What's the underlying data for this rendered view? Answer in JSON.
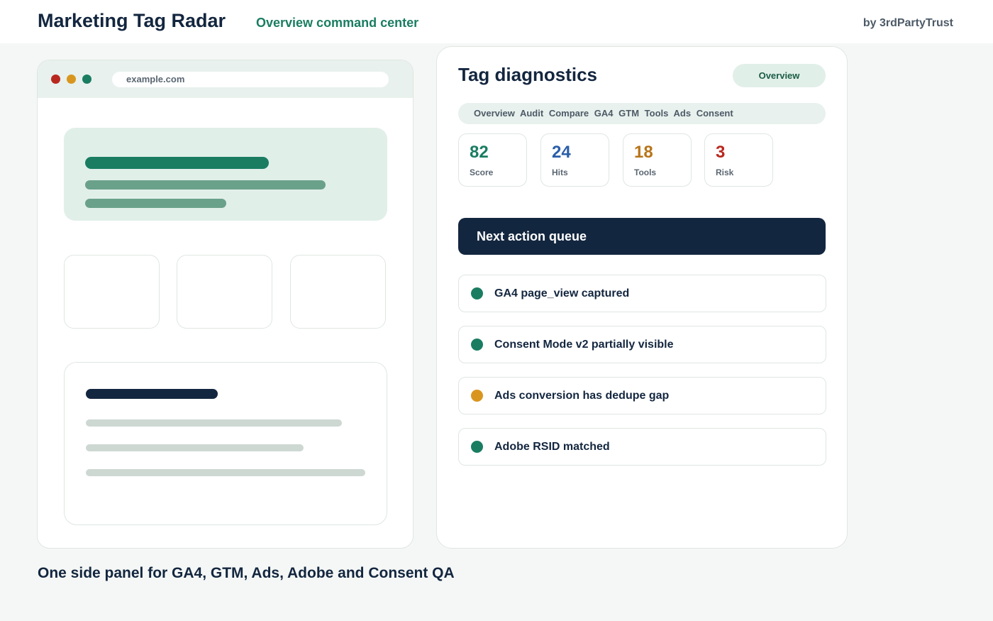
{
  "header": {
    "title": "Marketing Tag Radar",
    "subtitle": "Overview command center",
    "byline": "by 3rdPartyTrust"
  },
  "browser": {
    "url": "example.com",
    "colors": {
      "close": "#b8281f",
      "minimize": "#d9961f",
      "maximize": "#1a7d61"
    }
  },
  "panel": {
    "title": "Tag diagnostics",
    "badge": "Overview",
    "tabs": [
      "Overview",
      "Audit",
      "Compare",
      "GA4",
      "GTM",
      "Tools",
      "Ads",
      "Consent"
    ],
    "stats": [
      {
        "value": "82",
        "label": "Score",
        "color": "#1a7d61"
      },
      {
        "value": "24",
        "label": "Hits",
        "color": "#2a5ea8"
      },
      {
        "value": "18",
        "label": "Tools",
        "color": "#b7751a"
      },
      {
        "value": "3",
        "label": "Risk",
        "color": "#b8281f"
      }
    ],
    "queue_title": "Next action queue",
    "queue": [
      {
        "label": "GA4 page_view captured",
        "status_color": "#1a7d61"
      },
      {
        "label": "Consent Mode v2 partially visible",
        "status_color": "#1a7d61"
      },
      {
        "label": "Ads conversion has dedupe gap",
        "status_color": "#d9961f"
      },
      {
        "label": "Adobe RSID matched",
        "status_color": "#1a7d61"
      }
    ]
  },
  "footer": {
    "caption": "One side panel for GA4, GTM, Ads, Adobe and Consent QA"
  }
}
